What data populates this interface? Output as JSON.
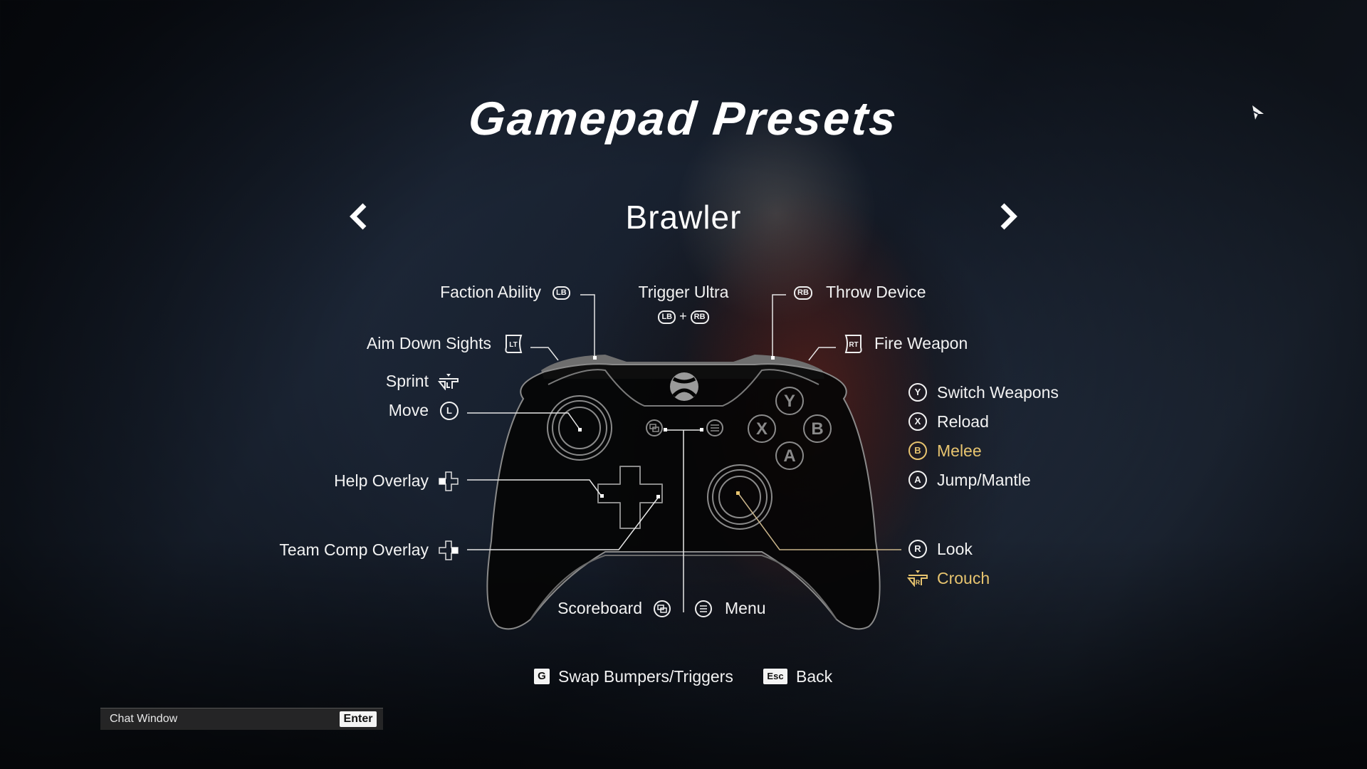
{
  "screen": {
    "title": "Gamepad Presets",
    "preset_name": "Brawler",
    "prev_icon": "chevron-left-icon",
    "next_icon": "chevron-right-icon"
  },
  "colors": {
    "text": "#f2f2f2",
    "highlight": "#e7c46f",
    "controller_body": "#050505",
    "controller_outline": "#8a8a8a",
    "bumper": "#6e6e6e"
  },
  "bindings_top": {
    "faction_ability": {
      "label": "Faction Ability",
      "button": "LB"
    },
    "trigger_ultra": {
      "label": "Trigger Ultra",
      "combo": [
        "LB",
        "RB"
      ],
      "plus": "+"
    },
    "throw_device": {
      "label": "Throw Device",
      "button": "RB"
    },
    "aim_down_sights": {
      "label": "Aim Down Sights",
      "button": "LT"
    },
    "fire_weapon": {
      "label": "Fire Weapon",
      "button": "RT"
    }
  },
  "bindings_left": {
    "sprint": {
      "label": "Sprint",
      "button": "LS-click"
    },
    "move": {
      "label": "Move",
      "button": "L"
    },
    "help_overlay": {
      "label": "Help Overlay",
      "button": "dpad-left"
    },
    "team_comp_overlay": {
      "label": "Team Comp Overlay",
      "button": "dpad-right"
    }
  },
  "bindings_right": [
    {
      "label": "Switch Weapons",
      "button": "Y",
      "highlight": false
    },
    {
      "label": "Reload",
      "button": "X",
      "highlight": false
    },
    {
      "label": "Melee",
      "button": "B",
      "highlight": true
    },
    {
      "label": "Jump/Mantle",
      "button": "A",
      "highlight": false
    }
  ],
  "bindings_right_lower": {
    "look": {
      "label": "Look",
      "button": "R"
    },
    "crouch": {
      "label": "Crouch",
      "button": "RS-click",
      "highlight": true
    }
  },
  "bindings_bottom": {
    "scoreboard": {
      "label": "Scoreboard",
      "button": "view"
    },
    "menu": {
      "label": "Menu",
      "button": "menu"
    }
  },
  "controller": {
    "face_buttons": [
      "Y",
      "X",
      "B",
      "A"
    ],
    "logo": "xbox-logo"
  },
  "footer": {
    "swap": {
      "key": "G",
      "label": "Swap Bumpers/Triggers"
    },
    "back": {
      "key": "Esc",
      "label": "Back"
    }
  },
  "chat": {
    "label": "Chat Window",
    "key": "Enter"
  }
}
